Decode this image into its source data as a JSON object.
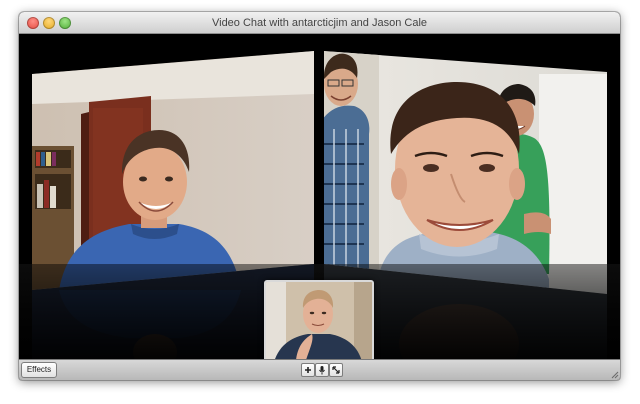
{
  "window": {
    "title": "Video Chat with antarcticjim and Jason Cale"
  },
  "toolbar": {
    "effects_label": "Effects",
    "add_participant_icon": "plus-icon",
    "mute_icon": "microphone-icon",
    "fullscreen_icon": "expand-arrows-icon"
  },
  "colors": {
    "close": "#e2463b",
    "minimize": "#e3a81c",
    "zoom": "#4aa930",
    "titlebar": "#d8d8d8",
    "stage": "#000000"
  }
}
